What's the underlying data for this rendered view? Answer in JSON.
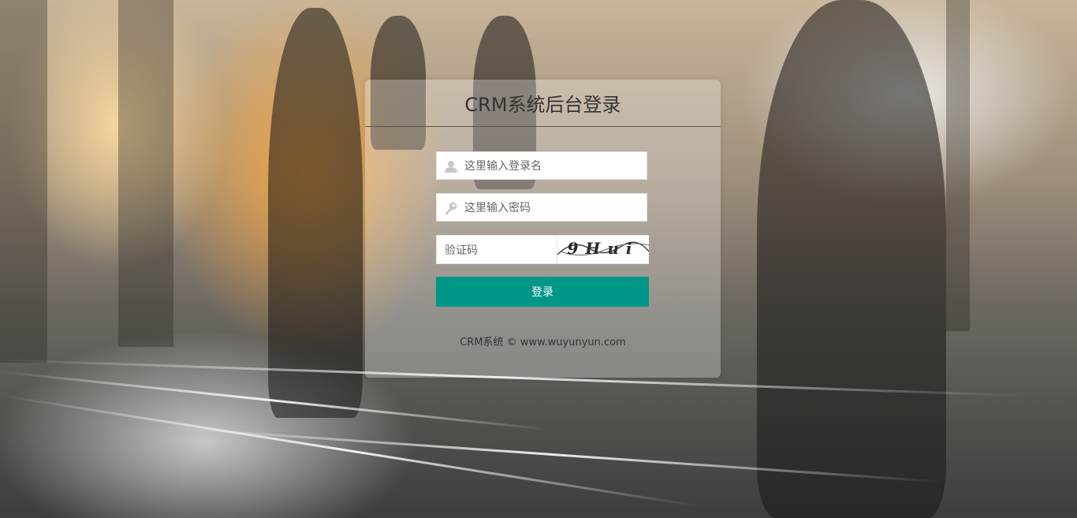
{
  "login": {
    "title": "CRM系统后台登录",
    "username": {
      "placeholder": "这里输入登录名",
      "value": ""
    },
    "password": {
      "placeholder": "这里输入密码",
      "value": ""
    },
    "captcha": {
      "placeholder": "验证码",
      "value": "",
      "image_text": "9Hui"
    },
    "submit_label": "登录",
    "footer": "CRM系统 © www.wuyunyun.com"
  },
  "icons": {
    "username": "user-icon",
    "password": "key-icon"
  },
  "colors": {
    "accent": "#009688",
    "title": "#333333"
  }
}
